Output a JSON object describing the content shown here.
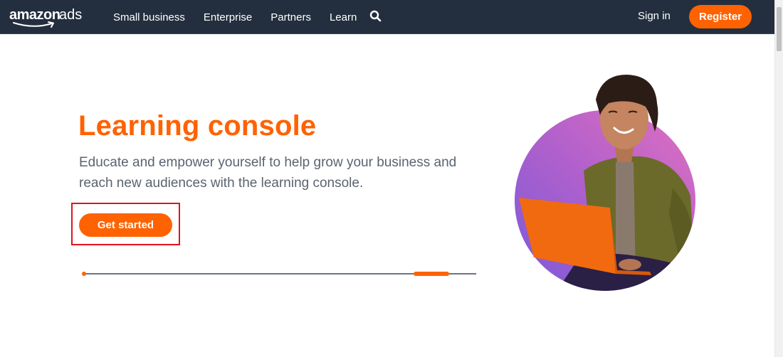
{
  "navbar": {
    "logo": {
      "brand": "amazon",
      "product": "ads",
      "icon": "amazon-smile-logo"
    },
    "links": [
      {
        "label": "Small business"
      },
      {
        "label": "Enterprise"
      },
      {
        "label": "Partners"
      },
      {
        "label": "Learn"
      }
    ],
    "search_icon": "search-icon",
    "sign_in_label": "Sign in",
    "register_label": "Register"
  },
  "hero": {
    "title": "Learning console",
    "description": "Educate and empower yourself to help grow your business and reach new audiences with the learning console.",
    "cta_label": "Get started",
    "carousel_progress": 0.92,
    "image_alt": "Smiling man in olive jacket using an orange laptop in front of a purple-pink gradient circle"
  },
  "colors": {
    "brand_orange": "#ff6200",
    "navbar_bg": "#232f3e",
    "text_gray": "#5a6470",
    "highlight_red": "#e0141e"
  }
}
